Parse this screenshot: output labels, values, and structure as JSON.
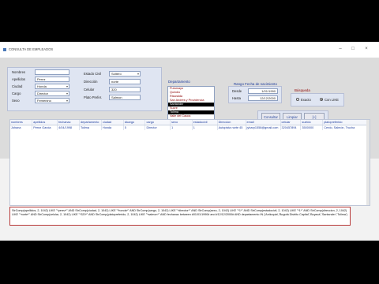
{
  "window": {
    "title": "CONSULTA DE EMPLEADOS"
  },
  "form": {
    "fields": {
      "nombres": {
        "label": "Nombres",
        "value": ""
      },
      "apellidos": {
        "label": "Apellidos",
        "value": "Perez"
      },
      "ciudad": {
        "label": "Ciudad",
        "value": "Honda"
      },
      "cargo": {
        "label": "Cargo",
        "value": "Director"
      },
      "sexo": {
        "label": "Sexo",
        "value": "Femenino"
      },
      "estado_civil": {
        "label": "Estado Civil",
        "value": "Soltero"
      },
      "direccion": {
        "label": "Dirección",
        "value": "norte"
      },
      "celular": {
        "label": "Celular",
        "value": "320"
      },
      "plato": {
        "label": "Plato Prefer.",
        "value": "Salmon"
      }
    },
    "departamento": {
      "label": "Departamento",
      "items": [
        "Putumayo",
        "Quindío",
        "Risaralda",
        "San Andrés y Providencia",
        "Santander",
        "Sucre",
        "Tolima",
        "Valle del Cauca"
      ],
      "selected": [
        "Santander",
        "Tolima"
      ]
    },
    "rango": {
      "label": "Rango Fecha de nacimiento",
      "desde_label": "Desde",
      "desde_value": "1/01/1990",
      "hasta_label": "Hasta",
      "hasta_value": "12/12/2000"
    },
    "busqueda": {
      "label": "Búsqueda",
      "option_exacto": "Exacto",
      "option_like": "Con LIKE",
      "selected": "Con LIKE"
    },
    "buttons": {
      "consultar": "Consultar",
      "limpiar": "Limpiar",
      "extra": "[+]"
    }
  },
  "table": {
    "columns": [
      "nombres",
      "apellidos",
      "fechanac",
      "departamento",
      "ciudad",
      "idcargo",
      "cargo",
      "sexo",
      "estadocivil",
      "Direccion",
      "email",
      "celular",
      "sueldo",
      "platopreferido"
    ],
    "rows": [
      [
        "Johana",
        "Perez Garcia",
        "4/04/1998",
        "Tolima",
        "Honda",
        "5",
        "Director",
        "1",
        "1",
        "Autopista norte 45",
        "jyharp1558@gmail.com",
        "320457894",
        "3500000",
        "Cerdo, Salmón, Trucha"
      ]
    ]
  },
  "sql": {
    "text": "StrComp(apellidos, 2, 1042) LIKE \"*perez*\" AND StrComp(ciudad, 2, 1042) LIKE \"*honda*\" AND StrComp(cargo, 2, 1042) LIKE \"*director*\" AND StrComp(sexo, 2, 1042) LIKE \"*1*\" AND StrComp(estadocivil, 2, 1042) LIKE \"*1*\" AND StrComp(direccion, 2, 1042) LIKE \"*norte*\" AND StrComp(celular, 2, 1042) LIKE \"*320*\" AND StrComp(platopreferido, 2, 1042) LIKE \"*salmon*\" AND fechanac between #01/01/1990# and #12/12/2000# AND departamento IN ('Antioquia','Bogotá Distrito Capital','Boyacá','Santander','Tolima')"
  }
}
